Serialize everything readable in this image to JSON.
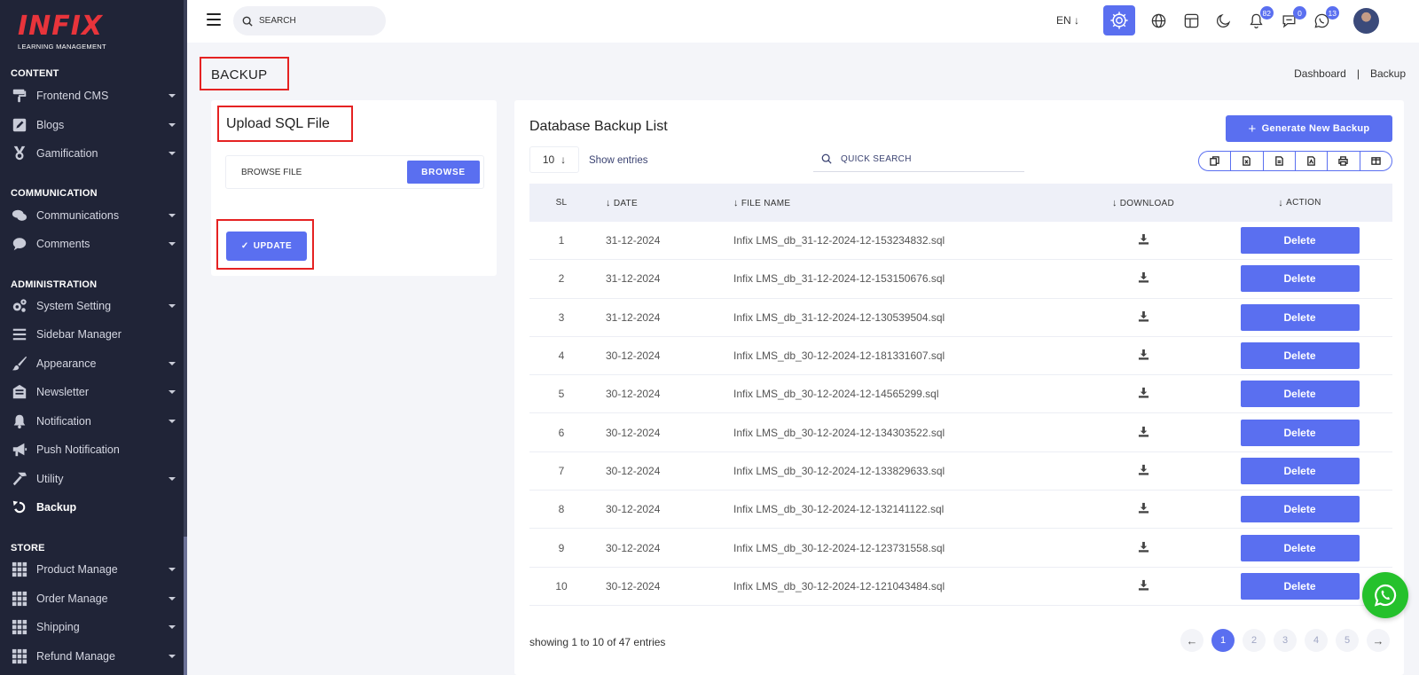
{
  "brand": {
    "name": "INFIX",
    "subtitle": "LEARNING MANAGEMENT"
  },
  "sidebar": {
    "sections": [
      {
        "title": "CONTENT",
        "items": [
          {
            "label": "Frontend CMS",
            "icon": "paint-roller-icon",
            "caret": true
          },
          {
            "label": "Blogs",
            "icon": "edit-icon",
            "caret": true
          },
          {
            "label": "Gamification",
            "icon": "medal-icon",
            "caret": true
          }
        ]
      },
      {
        "title": "COMMUNICATION",
        "items": [
          {
            "label": "Communications",
            "icon": "chat-bubbles-icon",
            "caret": true
          },
          {
            "label": "Comments",
            "icon": "comment-icon",
            "caret": true
          }
        ]
      },
      {
        "title": "ADMINISTRATION",
        "items": [
          {
            "label": "System Setting",
            "icon": "gears-icon",
            "caret": true
          },
          {
            "label": "Sidebar Manager",
            "icon": "bars-icon",
            "caret": false
          },
          {
            "label": "Appearance",
            "icon": "brush-icon",
            "caret": true
          },
          {
            "label": "Newsletter",
            "icon": "newsletter-icon",
            "caret": true
          },
          {
            "label": "Notification",
            "icon": "bell-icon",
            "caret": true
          },
          {
            "label": "Push Notification",
            "icon": "megaphone-icon",
            "caret": false
          },
          {
            "label": "Utility",
            "icon": "hammer-icon",
            "caret": true
          },
          {
            "label": "Backup",
            "icon": "undo-icon",
            "caret": false,
            "active": true
          }
        ]
      },
      {
        "title": "STORE",
        "items": [
          {
            "label": "Product Manage",
            "icon": "grid-icon",
            "caret": true
          },
          {
            "label": "Order Manage",
            "icon": "grid-icon",
            "caret": true
          },
          {
            "label": "Shipping",
            "icon": "grid-icon",
            "caret": true
          },
          {
            "label": "Refund Manage",
            "icon": "grid-icon",
            "caret": true
          }
        ]
      }
    ]
  },
  "topbar": {
    "search_placeholder": "SEARCH",
    "language": "EN ↓",
    "badges": {
      "notifications": "82",
      "messages": "0",
      "chats": "13"
    }
  },
  "page": {
    "title": "BACKUP",
    "breadcrumb": [
      "Dashboard",
      "|",
      "Backup"
    ]
  },
  "upload": {
    "title": "Upload SQL File",
    "file_label": "BROWSE FILE",
    "browse_label": "BROWSE",
    "update_label": "UPDATE",
    "update_check": "✓"
  },
  "backups": {
    "title": "Database Backup List",
    "generate_label": "Generate New Backup",
    "generate_plus": "+",
    "page_size": "10",
    "page_size_arrow": "↓",
    "show_entries": "Show entries",
    "search_placeholder": "QUICK SEARCH",
    "columns": {
      "sl": "SL",
      "date": "DATE",
      "file": "FILE NAME",
      "download": "DOWNLOAD",
      "action": "ACTION"
    },
    "sort_arrow": "↓",
    "delete_label": "Delete",
    "rows": [
      {
        "sl": "1",
        "date": "31-12-2024",
        "file": "Infix LMS_db_31-12-2024-12-153234832.sql"
      },
      {
        "sl": "2",
        "date": "31-12-2024",
        "file": "Infix LMS_db_31-12-2024-12-153150676.sql"
      },
      {
        "sl": "3",
        "date": "31-12-2024",
        "file": "Infix LMS_db_31-12-2024-12-130539504.sql"
      },
      {
        "sl": "4",
        "date": "30-12-2024",
        "file": "Infix LMS_db_30-12-2024-12-181331607.sql"
      },
      {
        "sl": "5",
        "date": "30-12-2024",
        "file": "Infix LMS_db_30-12-2024-12-14565299.sql"
      },
      {
        "sl": "6",
        "date": "30-12-2024",
        "file": "Infix LMS_db_30-12-2024-12-134303522.sql"
      },
      {
        "sl": "7",
        "date": "30-12-2024",
        "file": "Infix LMS_db_30-12-2024-12-133829633.sql"
      },
      {
        "sl": "8",
        "date": "30-12-2024",
        "file": "Infix LMS_db_30-12-2024-12-132141122.sql"
      },
      {
        "sl": "9",
        "date": "30-12-2024",
        "file": "Infix LMS_db_30-12-2024-12-123731558.sql"
      },
      {
        "sl": "10",
        "date": "30-12-2024",
        "file": "Infix LMS_db_30-12-2024-12-121043484.sql"
      }
    ],
    "showing": "showing 1 to 10 of 47 entries",
    "pages": [
      "1",
      "2",
      "3",
      "4",
      "5"
    ],
    "prev_arrow": "←",
    "next_arrow": "→",
    "current_page": "1"
  },
  "colors": {
    "accent": "#5a6ff0",
    "sidebar": "#202437",
    "highlight_box": "#e52222",
    "whatsapp": "#25c12c"
  }
}
